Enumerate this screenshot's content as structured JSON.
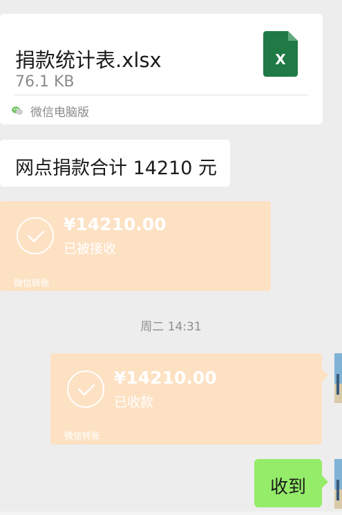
{
  "file_message": {
    "file_name": "捐款统计表.xlsx",
    "file_size": "76.1 KB",
    "file_icon": "excel-file-icon",
    "icon_letter": "X",
    "source_label": "微信电脑版",
    "source_icon": "wechat-icon"
  },
  "text_message": {
    "content": "网点捐款合计 14210 元"
  },
  "transfer_received": {
    "amount": "¥14210.00",
    "status": "已被接收",
    "brand": "微信转账"
  },
  "timestamp": "周二 14:31",
  "transfer_sent": {
    "amount": "¥14210.00",
    "status": "已收款",
    "brand": "微信转账"
  },
  "reply_message": {
    "content": "收到"
  },
  "colors": {
    "chat_background": "#ededed",
    "bubble_white": "#ffffff",
    "bubble_green": "#95ec69",
    "transfer_faded": "#fde1c3",
    "excel_green": "#1f7a45"
  }
}
